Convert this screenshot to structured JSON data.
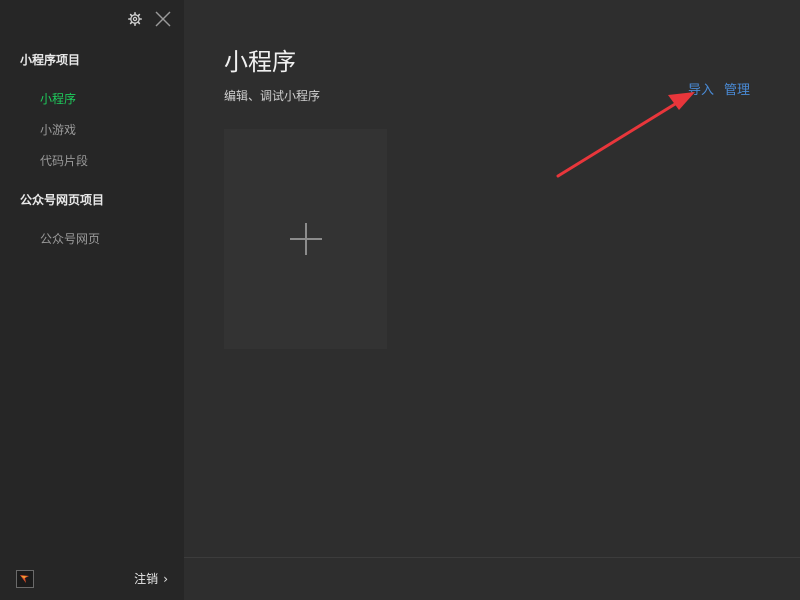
{
  "sidebar": {
    "icons": {
      "settings": "gear-icon",
      "close": "close-icon"
    },
    "sections": [
      {
        "title": "小程序项目",
        "items": [
          {
            "label": "小程序",
            "active": true
          },
          {
            "label": "小游戏",
            "active": false
          },
          {
            "label": "代码片段",
            "active": false
          }
        ]
      },
      {
        "title": "公众号网页项目",
        "items": [
          {
            "label": "公众号网页",
            "active": false
          }
        ]
      }
    ],
    "footer": {
      "logout_label": "注销",
      "chevron": "›"
    }
  },
  "main": {
    "title": "小程序",
    "subtitle": "编辑、调试小程序",
    "links": {
      "import": "导入",
      "manage": "管理"
    },
    "new_project_icon": "plus-icon"
  },
  "colors": {
    "accent_green": "#1ecb5c",
    "link_blue": "#4a8bd6",
    "annotation_red": "#e8363b"
  }
}
